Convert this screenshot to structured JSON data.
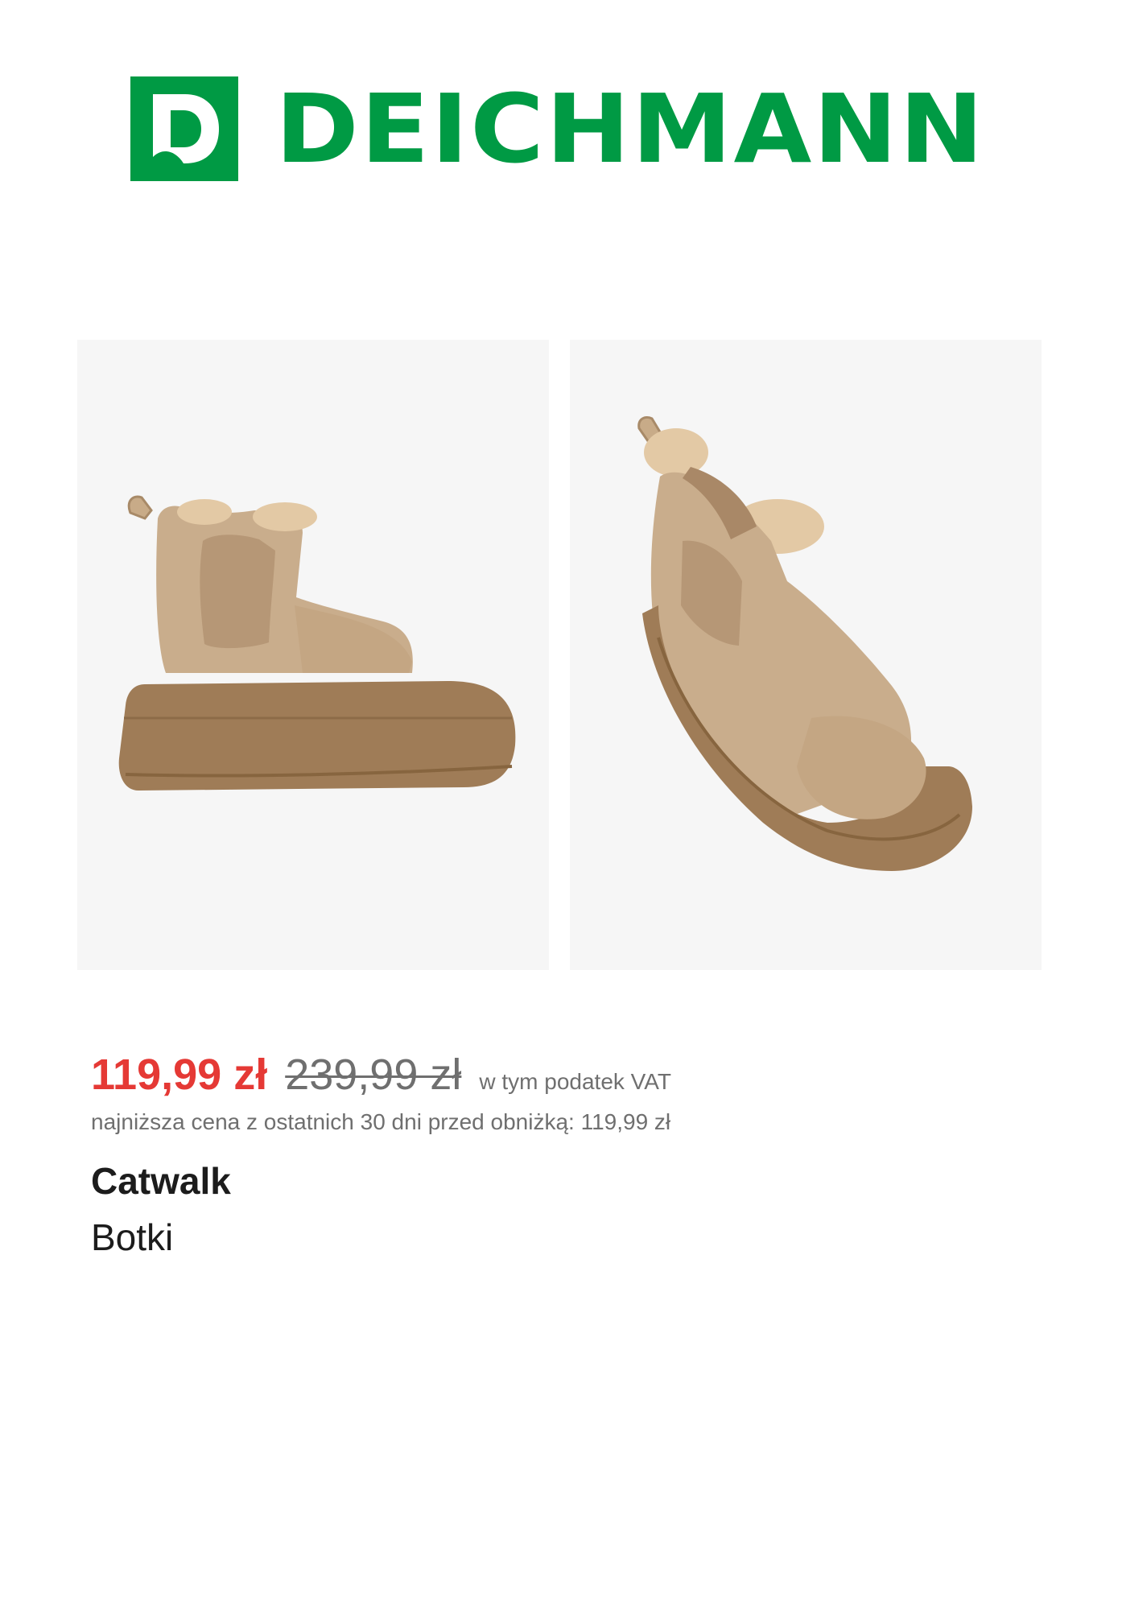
{
  "header": {
    "logo_text": "DEICHMANN",
    "brand_color": "#009a44"
  },
  "gallery": {
    "images": [
      {
        "icon": "ankle-boot-side-view"
      },
      {
        "icon": "ankle-boot-three-quarter-view"
      }
    ]
  },
  "product": {
    "price_current": "119,99 zł",
    "price_old": "239,99 zł",
    "vat_note": "w tym podatek VAT",
    "lowest_price_note": "najniższa cena z ostatnich 30 dni przed obniżką: 119,99 zł",
    "brand": "Catwalk",
    "category": "Botki"
  },
  "colors": {
    "sale_price": "#e53935",
    "muted_text": "#6f6f6f",
    "title_text": "#1c1c1c",
    "image_background": "#f6f6f6"
  }
}
